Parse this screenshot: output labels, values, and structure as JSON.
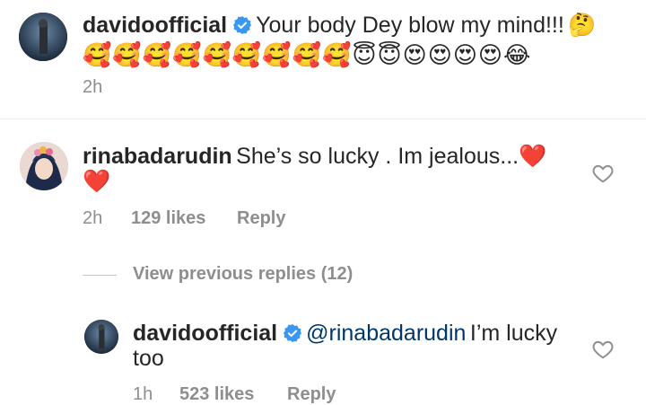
{
  "post": {
    "username": "davidoofficial",
    "caption": "Your body Dey blow my mind!!!",
    "caption_emoji_inline": "🤔",
    "emoji_line": [
      "🥰",
      "🥰",
      "🥰",
      "🥰",
      "🥰",
      "🥰",
      "🥰",
      "🥰",
      "🥰",
      "😇",
      "😇",
      "😍",
      "😍",
      "😍",
      "😍",
      "😂"
    ],
    "time": "2h"
  },
  "comment": {
    "username": "rinabadarudin",
    "text": "She’s so lucky . Im jealous...",
    "text_emoji": "❤️",
    "second_line_emoji": "❤️",
    "time": "2h",
    "likes": "129 likes",
    "reply_label": "Reply"
  },
  "view_replies": "View previous replies (12)",
  "reply": {
    "username": "davidoofficial",
    "mention": "@rinabadarudin",
    "text": "I’m lucky",
    "text_line2": "too",
    "time": "1h",
    "likes": "523 likes",
    "reply_label": "Reply"
  },
  "colors": {
    "text": "#262626",
    "meta": "#8e8e8e",
    "verified": "#3897f0",
    "mention": "#00376b",
    "divider": "#efefef"
  }
}
